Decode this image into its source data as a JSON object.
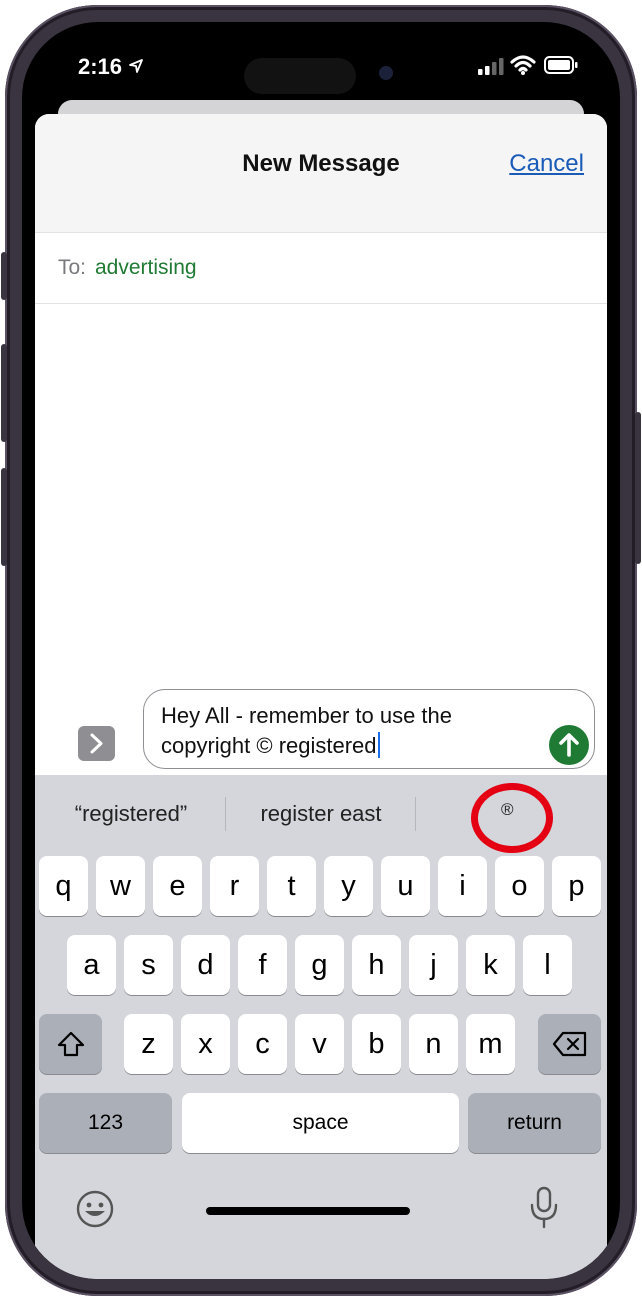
{
  "status_bar": {
    "time": "2:16",
    "icons": [
      "location-arrow-icon",
      "cellular-signal-icon",
      "wifi-icon",
      "battery-icon"
    ]
  },
  "header": {
    "title": "New Message",
    "cancel_label": "Cancel"
  },
  "recipient": {
    "label": "To:",
    "value": "advertising"
  },
  "compose": {
    "line1": "Hey All - remember to use the",
    "line2": "copyright © registered"
  },
  "suggestions": [
    "“registered”",
    "register east",
    "®"
  ],
  "keyboard": {
    "row1": [
      "q",
      "w",
      "e",
      "r",
      "t",
      "y",
      "u",
      "i",
      "o",
      "p"
    ],
    "row2": [
      "a",
      "s",
      "d",
      "f",
      "g",
      "h",
      "j",
      "k",
      "l"
    ],
    "row3": [
      "z",
      "x",
      "c",
      "v",
      "b",
      "n",
      "m"
    ],
    "numbers_label": "123",
    "space_label": "space",
    "return_label": "return"
  },
  "colors": {
    "accent_green": "#1f7a33",
    "link_blue": "#1a5bb8",
    "highlight_red": "#e40012"
  }
}
